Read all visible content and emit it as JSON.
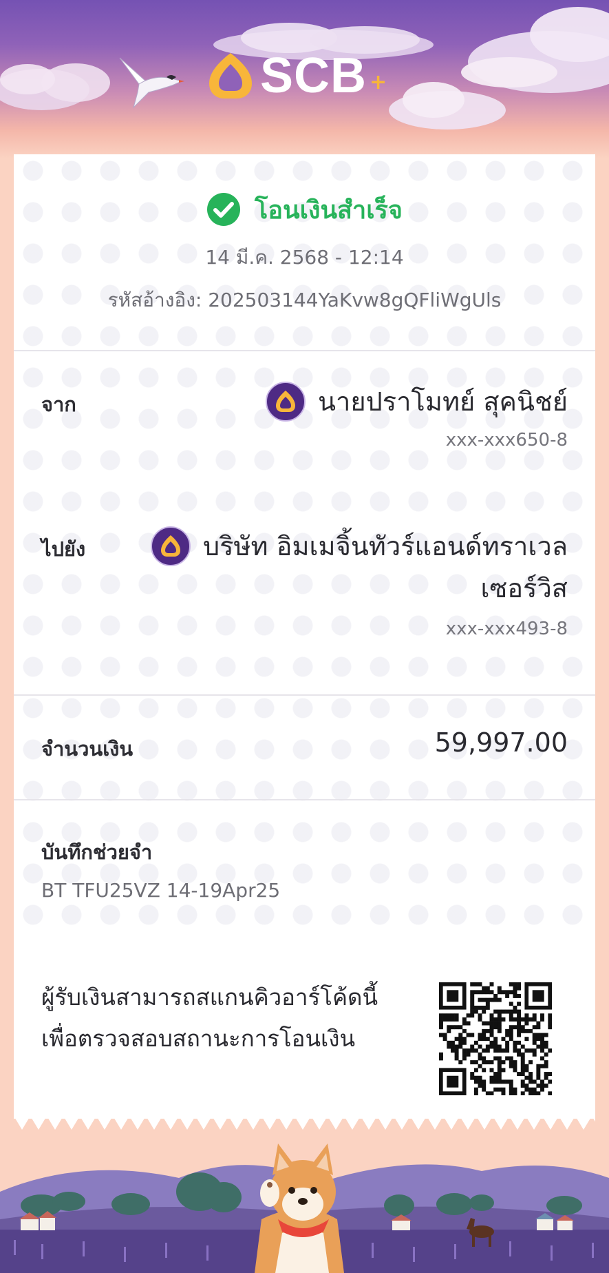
{
  "header": {
    "brand_name": "SCB",
    "brand_plus": "+"
  },
  "status": {
    "text": "โอนเงินสำเร็จ",
    "datetime": "14 มี.ค. 2568 - 12:14",
    "ref_label": "รหัสอ้างอิง:",
    "ref_value": "202503144YaKvw8gQFliWgUls"
  },
  "from": {
    "label": "จาก",
    "name": "นายปราโมทย์ สุคนิชย์",
    "account": "xxx-xxx650-8"
  },
  "to": {
    "label": "ไปยัง",
    "name_line1": "บริษัท อิมเมจิ้นทัวร์แอนด์ทราเวล",
    "name_line2": "เซอร์วิส",
    "account": "xxx-xxx493-8"
  },
  "amount": {
    "label": "จำนวนเงิน",
    "value": "59,997.00"
  },
  "memo": {
    "label": "บันทึกช่วยจำ",
    "value": "BT TFU25VZ 14-19Apr25"
  },
  "qr": {
    "line1": "ผู้รับเงินสามารถสแกนคิวอาร์โค้ดนี้",
    "line2": "เพื่อตรวจสอบสถานะการโอนเงิน"
  },
  "colors": {
    "success": "#27b35a",
    "brand_purple": "#4e2a84",
    "brand_gold": "#f8b63a"
  }
}
